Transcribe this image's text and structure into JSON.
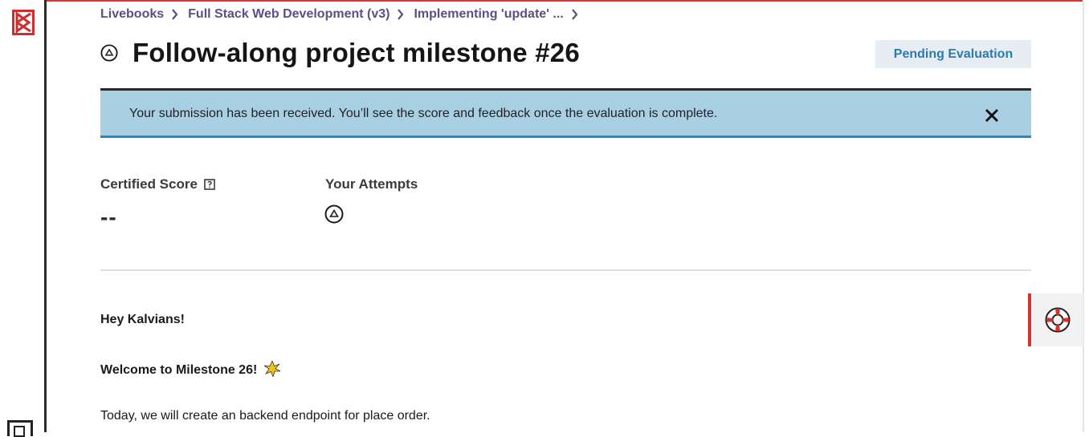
{
  "breadcrumb": {
    "items": [
      "Livebooks",
      "Full Stack Web Development (v3)",
      "Implementing 'update' ..."
    ]
  },
  "header": {
    "title": "Follow-along project milestone #26",
    "status_badge": "Pending Evaluation"
  },
  "alert": {
    "message": "Your submission has been received. You’ll see the score and feedback once the evaluation is complete."
  },
  "stats": {
    "certified_score_label": "Certified Score",
    "certified_score_value": "--",
    "attempts_label": "Your Attempts"
  },
  "content": {
    "greeting": "Hey Kalvians!",
    "welcome": "Welcome to Milestone 26!",
    "intro": "Today, we will create an backend endpoint for place order."
  },
  "colors": {
    "accent_red": "#d93535",
    "breadcrumb_purple": "#5c4f86",
    "badge_blue": "#2d7ab1",
    "alert_bg": "#a9d0e2"
  },
  "icons": [
    "logo-icon",
    "chevron-right-icon",
    "status-pending-icon",
    "close-icon",
    "info-icon",
    "attempt-pending-icon",
    "sparkle-icon",
    "lifebuoy-icon",
    "sidebar-bottom-icon"
  ]
}
